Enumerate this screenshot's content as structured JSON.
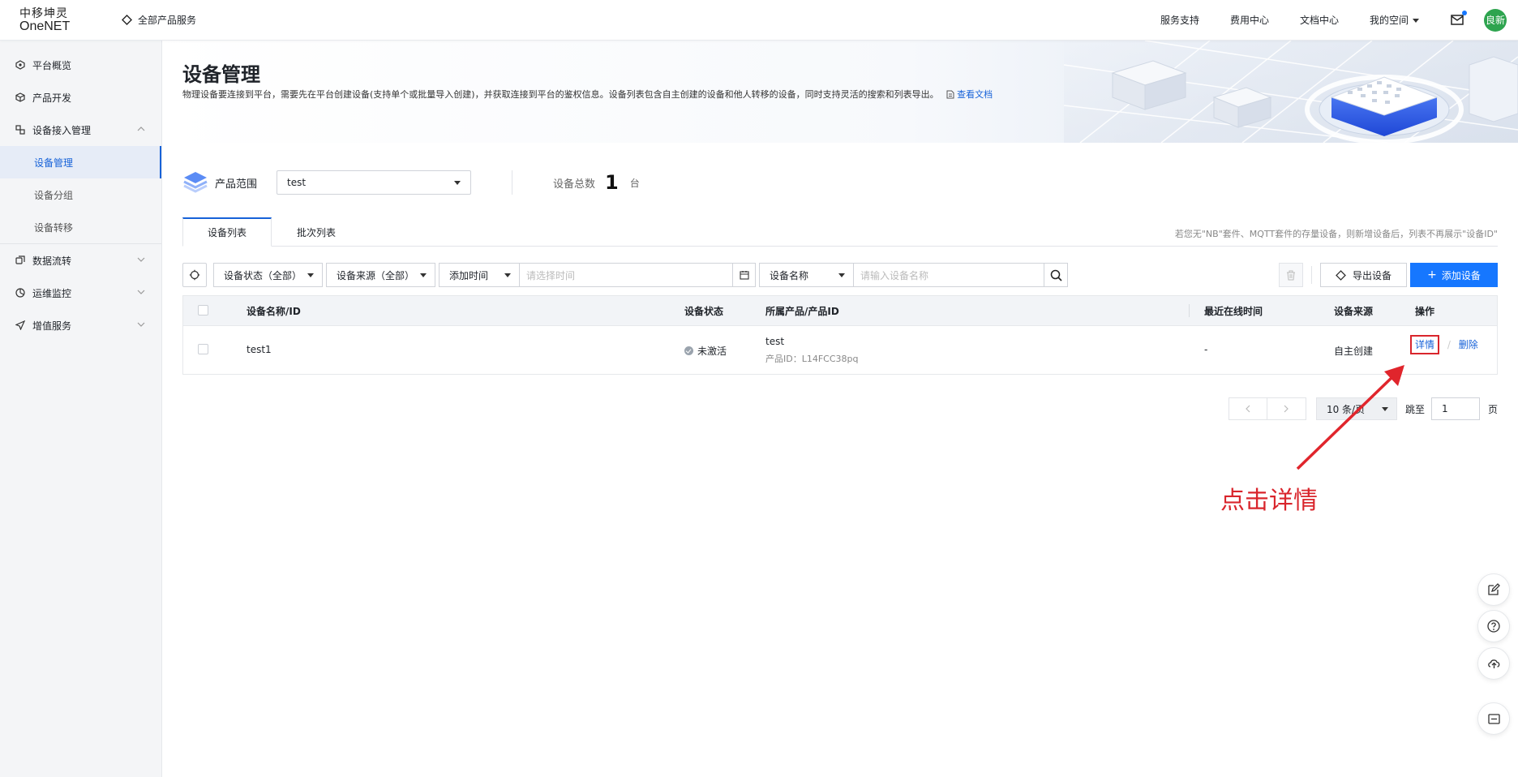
{
  "header": {
    "logo_line1": "中移坤灵",
    "logo_line2": "OneNET",
    "all_products": "全部产品服务",
    "nav": [
      "服务支持",
      "费用中心",
      "文档中心",
      "我的空间"
    ],
    "avatar_text": "良新",
    "accent": "#1677ff"
  },
  "sidebar": {
    "items": [
      {
        "label": "平台概览",
        "icon": "overview-icon"
      },
      {
        "label": "产品开发",
        "icon": "cube-icon"
      },
      {
        "label": "设备接入管理",
        "icon": "device-access-icon"
      },
      {
        "label": "设备管理",
        "sub": true,
        "active": true
      },
      {
        "label": "设备分组",
        "sub": true
      },
      {
        "label": "设备转移",
        "sub": true
      },
      {
        "label": "数据流转",
        "icon": "data-flow-icon"
      },
      {
        "label": "运维监控",
        "icon": "monitor-icon"
      },
      {
        "label": "增值服务",
        "icon": "plane-icon"
      }
    ]
  },
  "banner": {
    "title": "设备管理",
    "desc": "物理设备要连接到平台，需要先在平台创建设备(支持单个或批量导入创建)，并获取连接到平台的鉴权信息。设备列表包含自主创建的设备和他人转移的设备，同时支持灵活的搜索和列表导出。",
    "doc_link": "查看文档"
  },
  "scope": {
    "label": "产品范围",
    "selected": "test",
    "total_label": "设备总数",
    "total_value": "1",
    "total_unit": "台"
  },
  "tabs": {
    "items": [
      "设备列表",
      "批次列表"
    ],
    "note": "若您无\"NB\"套件、MQTT套件的存量设备，则新增设备后，列表不再展示\"设备ID\""
  },
  "filters": {
    "status": "设备状态（全部）",
    "source": "设备来源（全部）",
    "time": "添加时间",
    "time_placeholder": "请选择时间",
    "name": "设备名称",
    "name_placeholder": "请输入设备名称",
    "export": "导出设备",
    "add": "添加设备"
  },
  "table": {
    "headers": [
      "设备名称/ID",
      "设备状态",
      "所属产品/产品ID",
      "最近在线时间",
      "设备来源",
      "操作"
    ],
    "rows": [
      {
        "name": "test1",
        "status": "未激活",
        "product": "test",
        "product_id": "产品ID：L14FCC38pq",
        "last_online": "-",
        "source": "自主创建",
        "op_detail": "详情",
        "op_sep": "/",
        "op_delete": "删除"
      }
    ]
  },
  "pager": {
    "page_size": "10 条/页",
    "jump_label": "跳至",
    "page": "1",
    "page_unit": "页"
  },
  "annotation": {
    "text": "点击详情",
    "color": "#d9252c"
  }
}
